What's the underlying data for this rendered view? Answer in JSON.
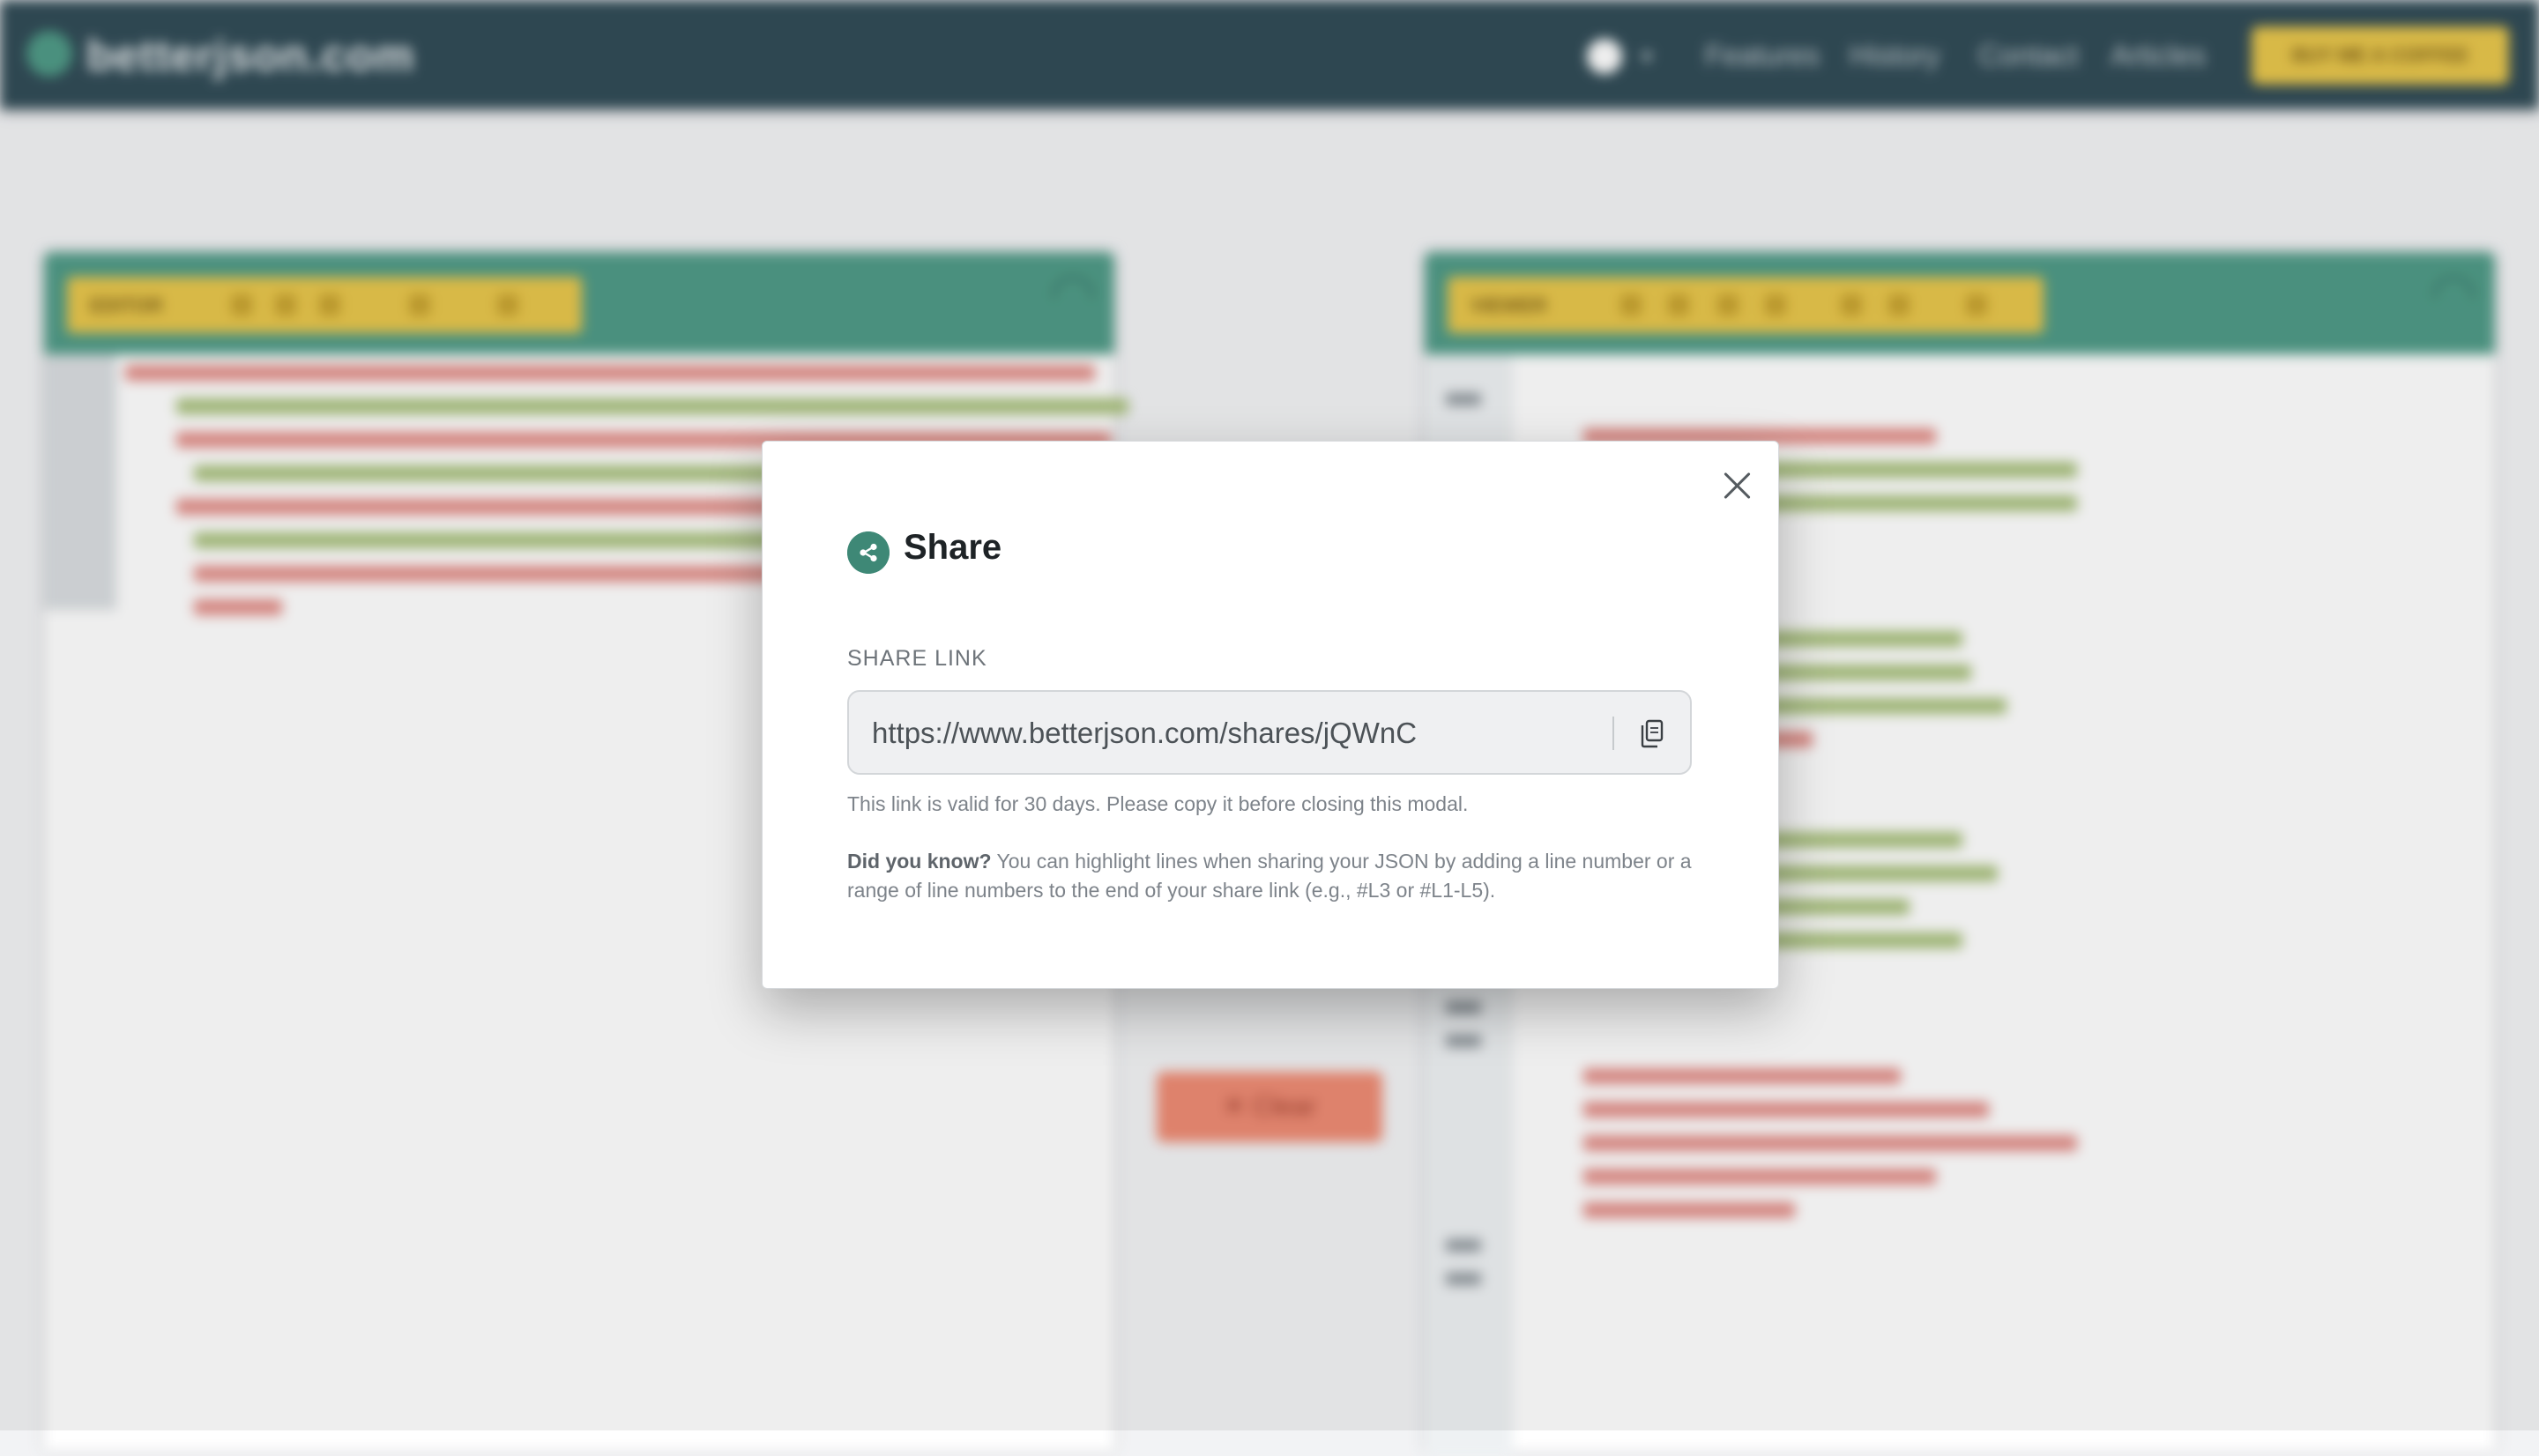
{
  "navbar": {
    "brand": "betterjson.com",
    "links": [
      "Features",
      "History",
      "Contact",
      "Articles"
    ],
    "coffee_label": "BUY ME A COFFEE"
  },
  "editor": {
    "toolbar_label": "EDITOR"
  },
  "viewer": {
    "toolbar_label": "VIEWER"
  },
  "clear_label": "✕ Clear",
  "modal": {
    "title": "Share",
    "field_label": "SHARE LINK",
    "link_value": "https://www.betterjson.com/shares/jQWnC",
    "validity_note": "This link is valid for 30 days. Please copy it before closing this modal.",
    "tip_lead": "Did you know?",
    "tip_text": " You can highlight lines when sharing your JSON by adding a line number or a range of line numbers to the end of your share link (e.g., #L3 or #L1-L5)."
  },
  "icons": {
    "share": "share-icon",
    "copy": "copy-icon",
    "close": "close-icon",
    "theme": "sun-icon"
  },
  "colors": {
    "navbar": "#2f4a55",
    "accent": "#4e9a86",
    "toolbar": "#e8c64a",
    "clear": "#ee8a72"
  }
}
